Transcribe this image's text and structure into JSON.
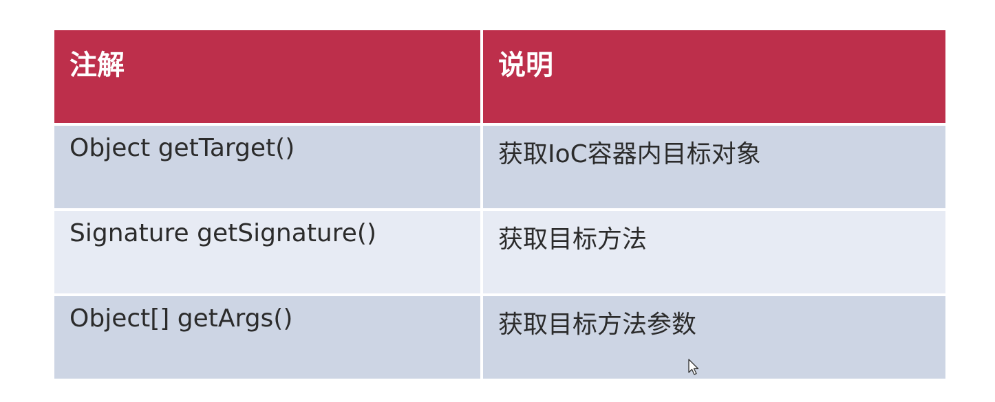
{
  "table": {
    "headers": [
      "注解",
      "说明"
    ],
    "rows": [
      [
        "Object getTarget()",
        "获取IoC容器内目标对象"
      ],
      [
        "Signature getSignature()",
        "获取目标方法"
      ],
      [
        "Object[] getArgs()",
        "获取目标方法参数"
      ]
    ]
  },
  "colors": {
    "header_bg": "#bd2f4b",
    "row_dark": "#cdd5e4",
    "row_light": "#e7ebf4"
  },
  "icons": {
    "cursor": "mouse-pointer-icon"
  }
}
